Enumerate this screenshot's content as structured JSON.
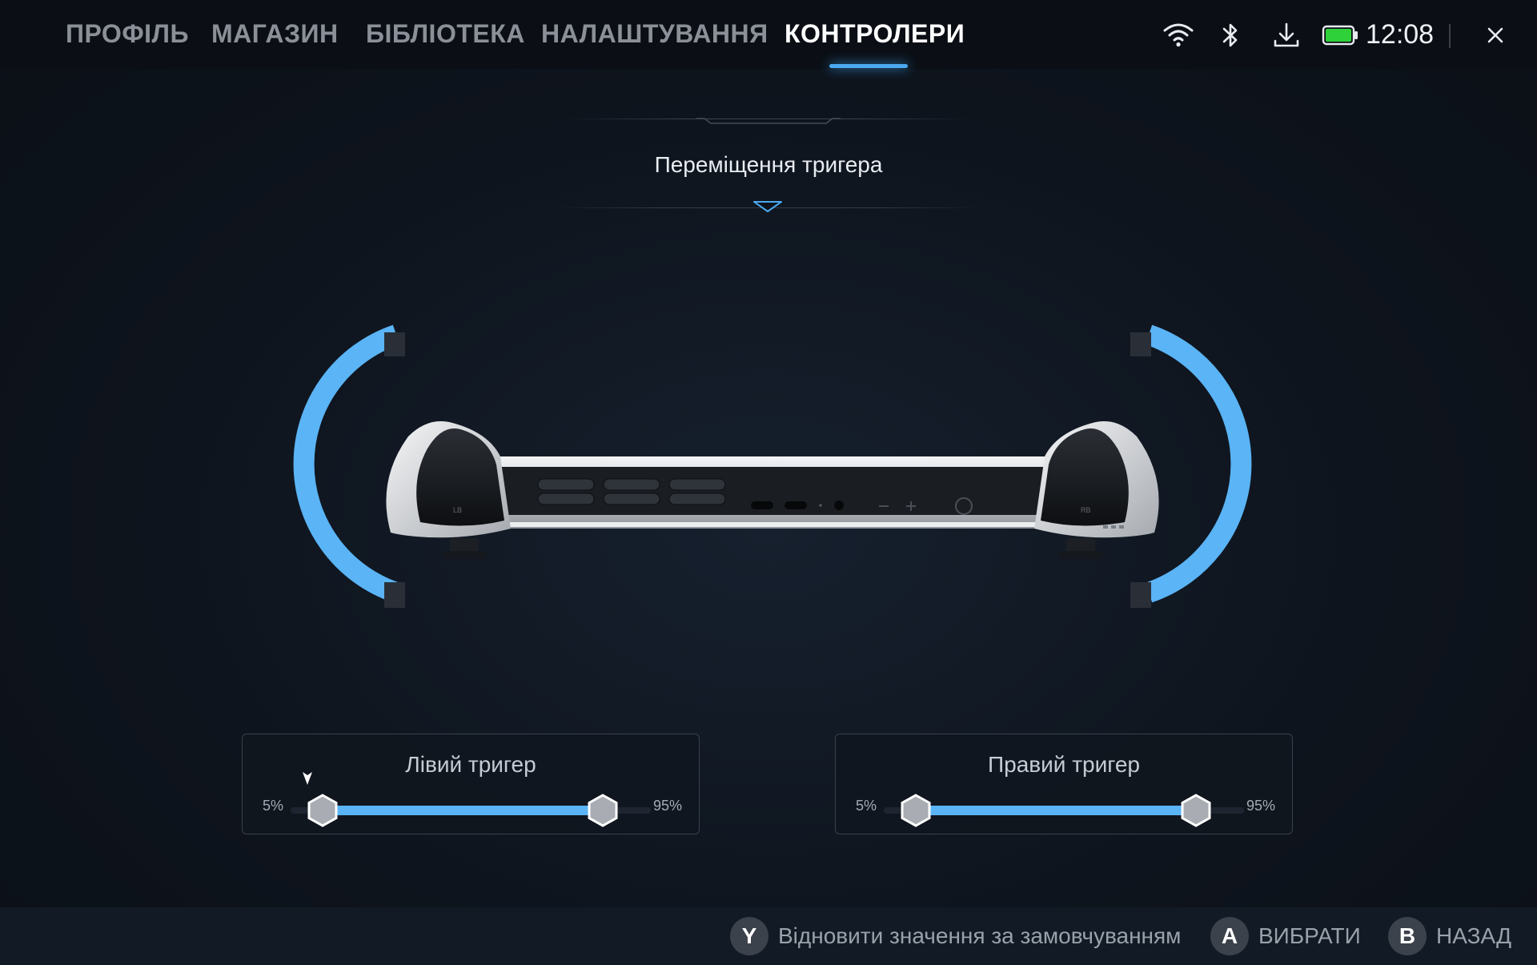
{
  "nav": {
    "tabs": [
      {
        "label": "ПРОФІЛЬ",
        "active": false
      },
      {
        "label": "МАГАЗИН",
        "active": false
      },
      {
        "label": "БІБЛІОТЕКА",
        "active": false
      },
      {
        "label": "НАЛАШТУВАННЯ",
        "active": false
      },
      {
        "label": "КОНТРОЛЕРИ",
        "active": true
      }
    ],
    "accent_color": "#4ba9f0"
  },
  "status": {
    "icons": [
      "wifi-icon",
      "bluetooth-icon",
      "download-icon",
      "battery-icon",
      "close-icon"
    ],
    "battery_level": 1.0,
    "battery_color": "#2fd13a",
    "time": "12:08"
  },
  "section": {
    "title": "Переміщення тригера"
  },
  "triggers": {
    "left": {
      "title": "Лівий тригер",
      "min_label": "5%",
      "max_label": "95%",
      "range_start_pct": 5,
      "range_end_pct": 95
    },
    "right": {
      "title": "Правий тригер",
      "min_label": "5%",
      "max_label": "95%",
      "range_start_pct": 5,
      "range_end_pct": 95
    }
  },
  "footer": {
    "hints": [
      {
        "button": "Y",
        "label": "Відновити значення за замовчуванням"
      },
      {
        "button": "A",
        "label": "ВИБРАТИ"
      },
      {
        "button": "B",
        "label": "НАЗАД"
      }
    ]
  }
}
